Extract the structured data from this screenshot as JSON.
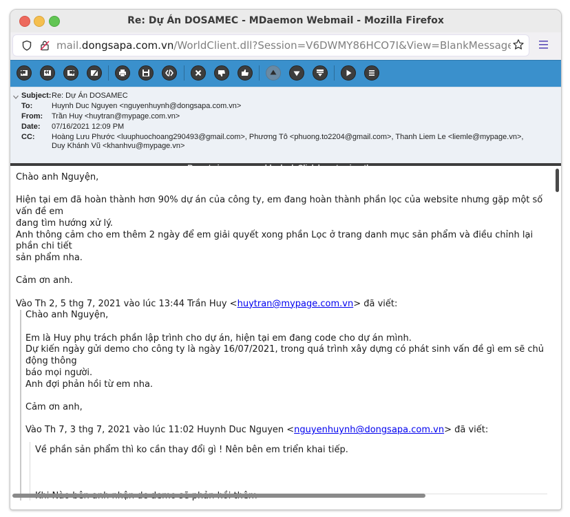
{
  "window": {
    "title": "Re: Dự Án DOSAMEC - MDaemon Webmail - Mozilla Firefox"
  },
  "urlbar": {
    "url_prefix": "mail.",
    "url_domain": "dongsapa.com.vn",
    "url_path": "/WorldClient.dll?Session=V6DWMY86HCO7I&View=BlankMessage&Exte"
  },
  "toolbar": {
    "buttons": [
      "reply-icon",
      "reply-all-icon",
      "forward-icon",
      "edit-icon",
      "print-icon",
      "save-icon",
      "source-icon",
      "delete-icon",
      "thumbs-down-icon",
      "thumbs-up-icon",
      "previous-icon",
      "next-icon",
      "archive-icon",
      "play-icon",
      "menu-icon"
    ]
  },
  "headers": {
    "subject_label": "Subject:",
    "subject": "Re: Dự Án DOSAMEC",
    "to_label": "To:",
    "to": "Huynh Duc Nguyen <nguyenhuynh@dongsapa.com.vn>",
    "from_label": "From:",
    "from": "Trần Huy <huytran@mypage.com.vn>",
    "date_label": "Date:",
    "date": "07/16/2021 12:09 PM",
    "cc_label": "CC:",
    "cc": "Hoàng Lưu Phước <luuphuochoang290493@gmail.com>, Phương Tô <phuong.to2204@gmail.com>, Thanh Liem Le <liemle@mypage.vn>, Duy Khánh Vũ <khanhvu@mypage.vn>"
  },
  "blocked_banner": "Remote images were blocked. Click here to view them.",
  "message": {
    "greeting": "Chào anh Nguyện,",
    "para1_line1": "Hiện tại em đã hoàn thành hơn 90% dự án của công ty, em đang hoàn thành phần lọc của website nhưng gặp một số vấn đề em",
    "para1_line2": "đang tìm hướng xử lý.",
    "para2_line1": "Anh thông cảm cho em thêm 2 ngày để em giải quyết xong phần Lọc ở trang danh mục sản phẩm và điều chỉnh lại phần chi tiết",
    "para2_line2": "sản phẩm nha.",
    "thanks": "Cảm ơn anh.",
    "attribution_prefix": "Vào Th 2, 5 thg 7, 2021 vào lúc 13:44 Trần Huy <",
    "attribution_email": "huytran@mypage.com.vn",
    "attribution_suffix": "> đã viết:"
  },
  "quote1": {
    "greeting": "Chào anh Nguyện,",
    "line1": "Em là Huy phụ trách phần lập trình cho dự án, hiện tại em đang code cho dự án mình.",
    "line2": "Dự kiến ngày gửi demo cho công ty là ngày 16/07/2021, trong quá trình xây dựng có phát sinh vấn đề gì em sẽ chủ động thông",
    "line3": "báo mọi người.",
    "line4": "Anh đợi phản hồi từ em nha.",
    "thanks": "Cảm ơn anh,",
    "attribution_prefix": "Vào Th 7, 3 thg 7, 2021 vào lúc 11:02 Huynh Duc Nguyen <",
    "attribution_email": "nguyenhuynh@dongsapa.com.vn",
    "attribution_suffix": "> đã viết:"
  },
  "quote2": {
    "line1": "Về phần sản phẩm thì ko cần thay đổi gì ! Nên bên em triển khai tiếp.",
    "line2": "Khi Nào bên anh nhận dc demo sẽ phản hồi thêm"
  }
}
